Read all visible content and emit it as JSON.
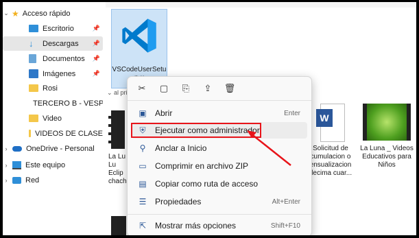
{
  "sidebar": {
    "items": [
      {
        "label": "Acceso rápido",
        "icon": "star-icon",
        "pinned": false
      },
      {
        "label": "Escritorio",
        "icon": "desktop-icon",
        "pinned": true
      },
      {
        "label": "Descargas",
        "icon": "download-icon",
        "pinned": true
      },
      {
        "label": "Documentos",
        "icon": "documents-icon",
        "pinned": true
      },
      {
        "label": "Imágenes",
        "icon": "pictures-icon",
        "pinned": true
      },
      {
        "label": "Rosi",
        "icon": "folder-icon",
        "pinned": false
      },
      {
        "label": "TERCERO B - VESPE",
        "icon": "folder-icon",
        "pinned": false
      },
      {
        "label": "Video",
        "icon": "folder-icon",
        "pinned": false
      },
      {
        "label": "VIDEOS DE CLASE",
        "icon": "folder-icon",
        "pinned": false
      },
      {
        "label": "OneDrive - Personal",
        "icon": "cloud-icon",
        "pinned": false
      },
      {
        "label": "Este equipo",
        "icon": "computer-icon",
        "pinned": false
      },
      {
        "label": "Red",
        "icon": "network-icon",
        "pinned": false
      }
    ]
  },
  "content": {
    "selected_file": "VSCodeUserSetup-x",
    "group_header": "al prir",
    "files": [
      {
        "label": "La Lu\nLu\nEclip\nchach",
        "type": "video"
      },
      {
        "label": "Solicitud de\ncumulacion o\nensualizacion\ndecima cuar...",
        "type": "word"
      },
      {
        "label": "La Luna _ Videos\nEducativos para\nNiños",
        "type": "video"
      }
    ]
  },
  "context_menu": {
    "top_icons": [
      "cut-icon",
      "copy-icon",
      "rename-icon",
      "share-icon",
      "delete-icon"
    ],
    "items": [
      {
        "label": "Abrir",
        "shortcut": "Enter",
        "icon": "open-icon"
      },
      {
        "label": "Ejecutar como administrador",
        "shortcut": "",
        "icon": "shield-icon"
      },
      {
        "label": "Anclar a Inicio",
        "shortcut": "",
        "icon": "pin-icon"
      },
      {
        "label": "Comprimir en archivo ZIP",
        "shortcut": "",
        "icon": "zip-icon"
      },
      {
        "label": "Copiar como ruta de acceso",
        "shortcut": "",
        "icon": "path-icon"
      },
      {
        "label": "Propiedades",
        "shortcut": "Alt+Enter",
        "icon": "properties-icon"
      },
      {
        "label": "Mostrar más opciones",
        "shortcut": "Shift+F10",
        "icon": "more-options-icon"
      }
    ]
  },
  "colors": {
    "highlight": "#e8141a",
    "arrow": "#e8141a",
    "selection": "#cde3f7",
    "vscode_blue": "#0065a9"
  }
}
